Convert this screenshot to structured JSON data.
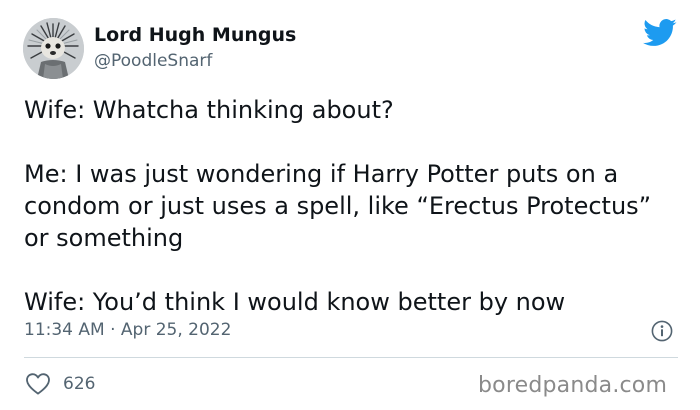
{
  "author": {
    "display_name": "Lord Hugh Mungus",
    "handle": "@PoodleSnarf",
    "avatar_icon": "poodle-avatar"
  },
  "tweet": {
    "paragraphs": [
      "Wife: Whatcha thinking about?",
      "Me: I was just wondering if Harry Potter puts on a condom or just uses a spell, like “Erectus Protectus” or something",
      "Wife: You’d think I would know better by now"
    ],
    "time": "11:34 AM",
    "separator": "·",
    "date": "Apr 25, 2022"
  },
  "engagement": {
    "likes": "626"
  },
  "watermark": "boredpanda.com",
  "colors": {
    "twitter_blue": "#1d9bf0",
    "text_primary": "#0f1419",
    "text_secondary": "#536471",
    "divider": "#cfd9de"
  }
}
